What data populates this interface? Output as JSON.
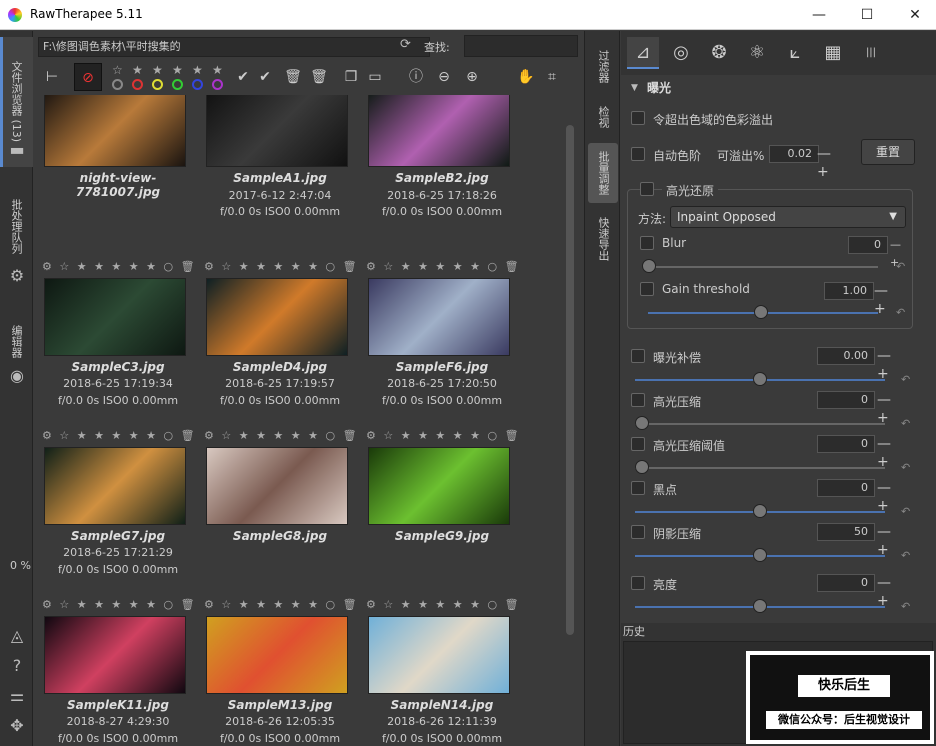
{
  "window": {
    "title": "RawTherapee 5.11"
  },
  "left_sidebar": {
    "tab_file_browser": "文件浏览器 (13)",
    "tab_batch_queue": "批处理队列",
    "tab_editor": "编辑器",
    "progress": "0 %"
  },
  "browser": {
    "path": "F:\\修图调色素材\\平时搜集的",
    "find_label": "查找:",
    "thumbs": [
      {
        "name": "night-view-7781007.jpg",
        "date": "",
        "exif": ""
      },
      {
        "name": "SampleA1.jpg",
        "date": "2017-6-12 2:47:04",
        "exif": "f/0.0 0s ISO0 0.00mm"
      },
      {
        "name": "SampleB2.jpg",
        "date": "2018-6-25 17:18:26",
        "exif": "f/0.0 0s ISO0 0.00mm"
      },
      {
        "name": "SampleC3.jpg",
        "date": "2018-6-25 17:19:34",
        "exif": "f/0.0 0s ISO0 0.00mm"
      },
      {
        "name": "SampleD4.jpg",
        "date": "2018-6-25 17:19:57",
        "exif": "f/0.0 0s ISO0 0.00mm"
      },
      {
        "name": "SampleF6.jpg",
        "date": "2018-6-25 17:20:50",
        "exif": "f/0.0 0s ISO0 0.00mm"
      },
      {
        "name": "SampleG7.jpg",
        "date": "2018-6-25 17:21:29",
        "exif": "f/0.0 0s ISO0 0.00mm"
      },
      {
        "name": "SampleG8.jpg",
        "date": "",
        "exif": ""
      },
      {
        "name": "SampleG9.jpg",
        "date": "",
        "exif": ""
      },
      {
        "name": "SampleK11.jpg",
        "date": "2018-8-27 4:29:30",
        "exif": "f/0.0 0s ISO0 0.00mm"
      },
      {
        "name": "SampleM13.jpg",
        "date": "2018-6-26 12:05:35",
        "exif": "f/0.0 0s ISO0 0.00mm"
      },
      {
        "name": "SampleN14.jpg",
        "date": "2018-6-26 12:11:39",
        "exif": "f/0.0 0s ISO0 0.00mm"
      }
    ],
    "rating_glyphs": "⚙ ☆ ★ ★ ★ ★ ★ ○ 🗑"
  },
  "mid_tabs": {
    "filter": "过滤器",
    "inspect": "检视",
    "batch_edit": "批量调整",
    "quick_export": "快速导出"
  },
  "panel": {
    "section_title": "曝光",
    "clip_label": "令超出色域的色彩溢出",
    "auto_levels": "自动色阶",
    "clip_pct_label": "可溢出%",
    "clip_pct_value": "0.02",
    "reset_button": "重置",
    "highlight_recovery": "高光还原",
    "method_label": "方法:",
    "method_value": "Inpaint Opposed",
    "blur_label": "Blur",
    "blur_value": "0",
    "gain_label": "Gain threshold",
    "gain_value": "1.00",
    "sliders": [
      {
        "label": "曝光补偿",
        "value": "0.00"
      },
      {
        "label": "高光压缩",
        "value": "0"
      },
      {
        "label": "高光压缩阈值",
        "value": "0"
      },
      {
        "label": "黑点",
        "value": "0"
      },
      {
        "label": "阴影压缩",
        "value": "50"
      },
      {
        "label": "亮度",
        "value": "0"
      }
    ],
    "history_label": "历史"
  },
  "watermark": {
    "line1": "快乐后生",
    "line2": "微信公众号：后生视觉设计"
  }
}
